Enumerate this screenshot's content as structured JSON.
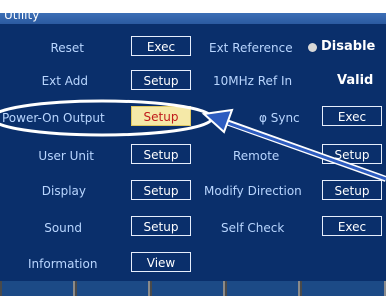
{
  "window": {
    "title": "Utility"
  },
  "left_rows": [
    {
      "label": "Reset",
      "button": "Exec"
    },
    {
      "label": "Ext Add",
      "button": "Setup"
    },
    {
      "label": "Power-On Output",
      "button": "Setup"
    },
    {
      "label": "User Unit",
      "button": "Setup"
    },
    {
      "label": "Display",
      "button": "Setup"
    },
    {
      "label": "Sound",
      "button": "Setup"
    },
    {
      "label": "Information",
      "button": "View"
    }
  ],
  "right_rows": [
    {
      "label": "Ext Reference",
      "value": "Disable"
    },
    {
      "label": "10MHz Ref In",
      "value": "Valid"
    },
    {
      "label": "φ Sync",
      "button": "Exec"
    },
    {
      "label": "Remote",
      "button": "Setup"
    },
    {
      "label": "Modify Direction",
      "button": "Setup"
    },
    {
      "label": "Self Check",
      "button": "Exec"
    }
  ],
  "highlight": {
    "row": "Power-On Output",
    "color": "#ffffff"
  }
}
